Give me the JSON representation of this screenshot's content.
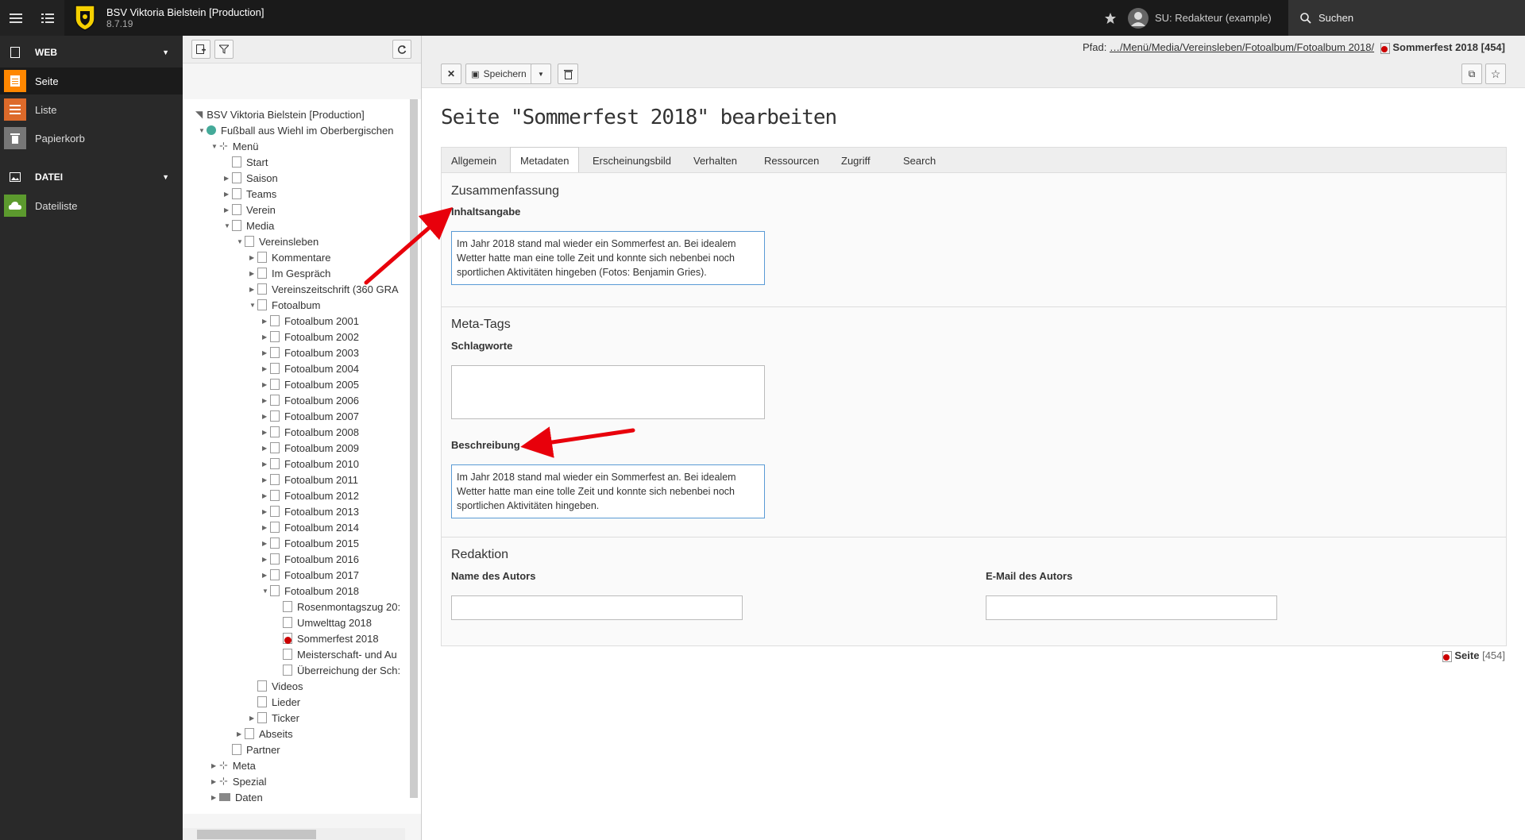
{
  "topbar": {
    "site_name": "BSV Viktoria Bielstein [Production]",
    "version": "8.7.19",
    "user": "SU: Redakteur (example)",
    "search_label": "Suchen"
  },
  "modules": {
    "web_label": "WEB",
    "items": [
      {
        "label": "Seite"
      },
      {
        "label": "Liste"
      },
      {
        "label": "Papierkorb"
      }
    ],
    "file_label": "DATEI",
    "file_items": [
      {
        "label": "Dateiliste"
      }
    ]
  },
  "tree": {
    "nodes": [
      {
        "label": "BSV Viktoria Bielstein [Production]"
      },
      {
        "label": "Fußball aus Wiehl im Oberbergischen"
      },
      {
        "label": "Menü"
      },
      {
        "label": "Start"
      },
      {
        "label": "Saison"
      },
      {
        "label": "Teams"
      },
      {
        "label": "Verein"
      },
      {
        "label": "Media"
      },
      {
        "label": "Vereinsleben"
      },
      {
        "label": "Kommentare"
      },
      {
        "label": "Im Gespräch"
      },
      {
        "label": "Vereinszeitschrift (360 GRA"
      },
      {
        "label": "Fotoalbum"
      },
      {
        "label": "Fotoalbum 2001"
      },
      {
        "label": "Fotoalbum 2002"
      },
      {
        "label": "Fotoalbum 2003"
      },
      {
        "label": "Fotoalbum 2004"
      },
      {
        "label": "Fotoalbum 2005"
      },
      {
        "label": "Fotoalbum 2006"
      },
      {
        "label": "Fotoalbum 2007"
      },
      {
        "label": "Fotoalbum 2008"
      },
      {
        "label": "Fotoalbum 2009"
      },
      {
        "label": "Fotoalbum 2010"
      },
      {
        "label": "Fotoalbum 2011"
      },
      {
        "label": "Fotoalbum 2012"
      },
      {
        "label": "Fotoalbum 2013"
      },
      {
        "label": "Fotoalbum 2014"
      },
      {
        "label": "Fotoalbum 2015"
      },
      {
        "label": "Fotoalbum 2016"
      },
      {
        "label": "Fotoalbum 2017"
      },
      {
        "label": "Fotoalbum 2018"
      },
      {
        "label": "Rosenmontagszug 20:"
      },
      {
        "label": "Umwelttag 2018"
      },
      {
        "label": "Sommerfest 2018"
      },
      {
        "label": "Meisterschaft- und Au"
      },
      {
        "label": "Überreichung der Sch:"
      },
      {
        "label": "Videos"
      },
      {
        "label": "Lieder"
      },
      {
        "label": "Ticker"
      },
      {
        "label": "Abseits"
      },
      {
        "label": "Partner"
      },
      {
        "label": "Meta"
      },
      {
        "label": "Spezial"
      },
      {
        "label": "Daten"
      }
    ]
  },
  "docheader": {
    "path_label": "Pfad:",
    "path_link": "…/Menü/Media/Vereinsleben/Fotoalbum/Fotoalbum 2018/",
    "path_current": "Sommerfest 2018 [454]",
    "save_label": "Speichern"
  },
  "main": {
    "title": "Seite \"Sommerfest 2018\" bearbeiten",
    "tabs": [
      {
        "label": "Allgemein"
      },
      {
        "label": "Metadaten"
      },
      {
        "label": "Erscheinungsbild"
      },
      {
        "label": "Verhalten"
      },
      {
        "label": "Ressourcen"
      },
      {
        "label": "Zugriff"
      },
      {
        "label": "Search"
      }
    ],
    "sections": {
      "summary_title": "Zusammenfassung",
      "abstract_label": "Inhaltsangabe",
      "abstract_value": "Im Jahr 2018 stand mal wieder ein Sommerfest an. Bei idealem Wetter hatte man eine tolle Zeit und konnte sich nebenbei noch sportlichen Aktivitäten hingeben (Fotos: Benjamin Gries).",
      "meta_title": "Meta-Tags",
      "keywords_label": "Schlagworte",
      "keywords_value": "",
      "description_label": "Beschreibung",
      "description_value": "Im Jahr 2018 stand mal wieder ein Sommerfest an. Bei idealem Wetter hatte man eine tolle Zeit und konnte sich nebenbei noch sportlichen Aktivitäten hingeben.",
      "editorial_title": "Redaktion",
      "author_label": "Name des Autors",
      "author_value": "",
      "email_label": "E-Mail des Autors",
      "email_value": ""
    },
    "footer_label": "Seite",
    "footer_id": "[454]"
  },
  "colors": {
    "accent_orange": "#ff8700",
    "arrow_red": "#e8000b",
    "focus_border": "#5a9bd5"
  }
}
